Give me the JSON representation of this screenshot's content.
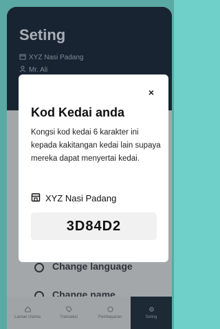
{
  "header": {
    "title": "Seting",
    "shop_name": "XYZ Nasi Padang",
    "user_name": "Mr. Ali"
  },
  "menu": {
    "item_1": "Change language",
    "item_2": "Change name"
  },
  "nav": {
    "items": [
      {
        "label": "Laman Utama",
        "icon": "home-icon"
      },
      {
        "label": "Transaksi",
        "icon": "tag-icon"
      },
      {
        "label": "Pembayaran",
        "icon": "payment-icon"
      },
      {
        "label": "Seting",
        "icon": "gear-icon"
      }
    ],
    "active": "Seting"
  },
  "modal": {
    "close_label": "×",
    "title": "Kod Kedai anda",
    "description": "Kongsi kod kedai 6 karakter ini kepada kakitangan kedai lain supaya mereka dapat menyertai kedai.",
    "shop_name": "XYZ Nasi Padang",
    "code": "3D84D2"
  },
  "colors": {
    "background": "#6fcfc9",
    "header": "#1f2d3e",
    "modal": "#ffffff"
  }
}
